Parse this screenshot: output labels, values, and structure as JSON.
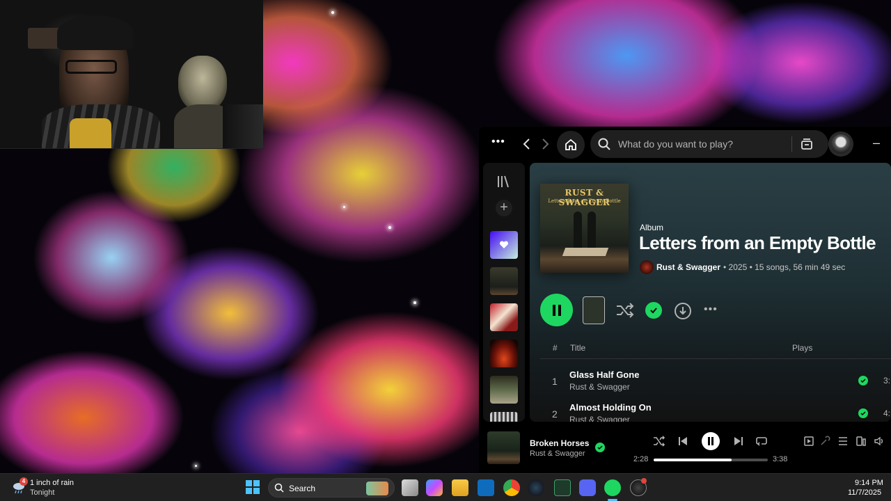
{
  "spotify": {
    "search_placeholder": "What do you want to play?",
    "album": {
      "type_label": "Album",
      "title": "Letters from an Empty Bottle",
      "artist": "Rust & Swagger",
      "meta": "• 2025 • 15 songs, 56 min 49 sec",
      "cover_title": "RUST & SWAGGER",
      "cover_subtitle": "Letters from an Empty Bottle"
    },
    "tracklist": {
      "header_num": "#",
      "header_title": "Title",
      "header_plays": "Plays",
      "tracks": [
        {
          "num": "1",
          "title": "Glass Half Gone",
          "artist": "Rust & Swagger",
          "duration": "3:"
        },
        {
          "num": "2",
          "title": "Almost Holding On",
          "artist": "Rust & Swagger",
          "duration": "4:"
        }
      ]
    },
    "now_playing": {
      "title": "Broken Horses",
      "artist": "Rust & Swagger",
      "position": "2:28",
      "duration": "3:38",
      "progress_fraction": 0.68
    },
    "accent_color": "#1ed760"
  },
  "taskbar": {
    "weather_badge": "4",
    "weather_main": "1 inch of rain",
    "weather_sub": "Tonight",
    "search_label": "Search",
    "clock_time": "9:14 PM",
    "clock_date": "11/7/2025"
  }
}
